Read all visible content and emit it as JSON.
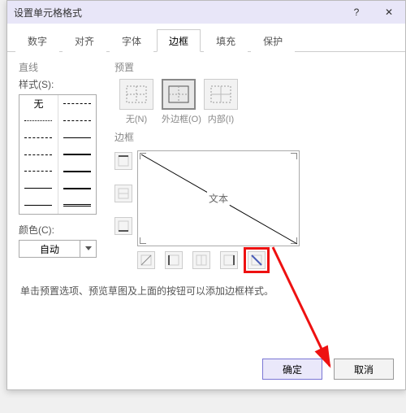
{
  "title": "设置单元格格式",
  "titlebar": {
    "help": "?",
    "close": "✕"
  },
  "tabs": [
    "数字",
    "对齐",
    "字体",
    "边框",
    "填充",
    "保护"
  ],
  "active_tab": 3,
  "left": {
    "line_section": "直线",
    "style_label": "样式(S):",
    "none_label": "无",
    "color_label": "颜色(C):",
    "color_value": "自动"
  },
  "right": {
    "preset_section": "预置",
    "presets": [
      {
        "caption": "无(N)"
      },
      {
        "caption": "外边框(O)"
      },
      {
        "caption": "内部(I)"
      }
    ],
    "border_section": "边框",
    "preview_text": "文本"
  },
  "hint": "单击预置选项、预览草图及上面的按钮可以添加边框样式。",
  "footer": {
    "ok": "确定",
    "cancel": "取消"
  }
}
